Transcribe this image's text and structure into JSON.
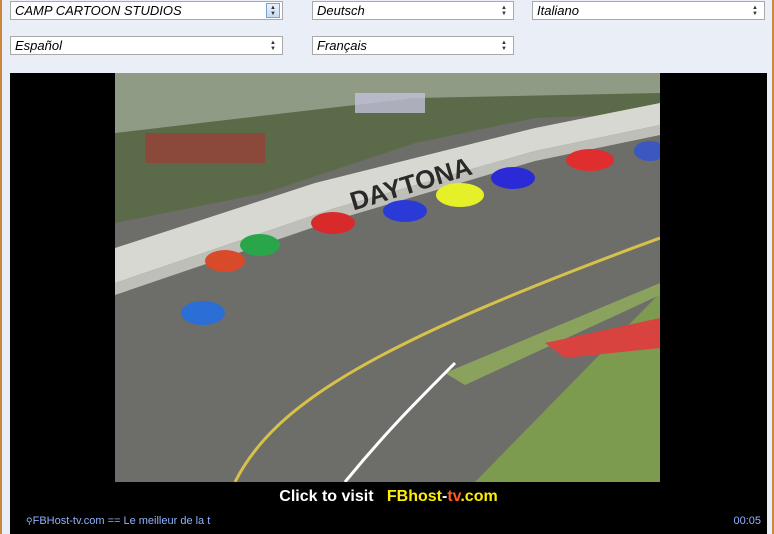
{
  "dropdowns": {
    "studio": {
      "value": "CAMP CARTOON STUDIOS"
    },
    "deutsch": {
      "value": "Deutsch"
    },
    "italiano": {
      "value": "Italiano"
    },
    "espanol": {
      "value": "Español"
    },
    "francais": {
      "value": "Français"
    }
  },
  "player": {
    "visit_prefix": "Click to visit",
    "brand_part1": "FBhost",
    "brand_dash": "-",
    "brand_part2": "tv",
    "brand_part3": ".com",
    "ticker_icon": "signal-icon",
    "ticker_text": "FBHost-tv.com == Le meilleur de la t",
    "time": "00:05",
    "video_banner": "DAYTONA"
  },
  "colors": {
    "brand_yellow": "#ffee00",
    "brand_orange": "#ff5a1f",
    "ticker_blue": "#8fb2ff",
    "player_bg": "#000000"
  }
}
